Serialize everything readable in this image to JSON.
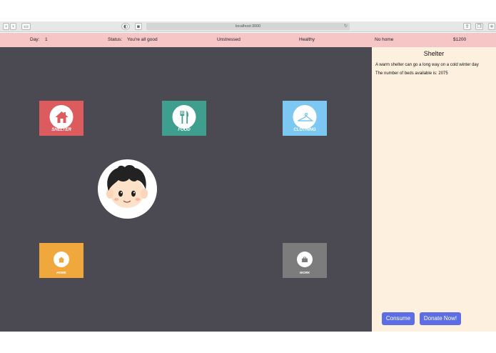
{
  "browser": {
    "url": "localhost:3000"
  },
  "status_bar": {
    "day_label": "Day:",
    "day_value": "1",
    "status_label": "Status:",
    "status_value": "You're all good",
    "stress": "Unstressed",
    "health": "Healthy",
    "home": "No home",
    "money": "$1200"
  },
  "tiles": {
    "shelter": {
      "label": "SHELTER",
      "color": "#dc5b5e",
      "icon": "house-icon"
    },
    "food": {
      "label": "FOOD",
      "color": "#3f9f8e",
      "icon": "fork-knife-icon"
    },
    "clothing": {
      "label": "CLOTHING",
      "color": "#7cc8f2",
      "icon": "hanger-icon"
    },
    "home": {
      "label": "HOME",
      "color": "#f0a83d",
      "icon": "house-icon"
    },
    "work": {
      "label": "WORK",
      "color": "#7c7c7c",
      "icon": "briefcase-icon"
    }
  },
  "panel": {
    "title": "Shelter",
    "description": "A warm shelter can go a long way on a cold winter day",
    "beds_text": "The number of beds available is: 2075",
    "consume_label": "Consume",
    "donate_label": "Donate Now!",
    "button_color": "#5d6ee4",
    "background_color": "#fdf0df"
  },
  "colors": {
    "status_bar": "#f6c5c6",
    "game_background": "#4b4a53"
  }
}
